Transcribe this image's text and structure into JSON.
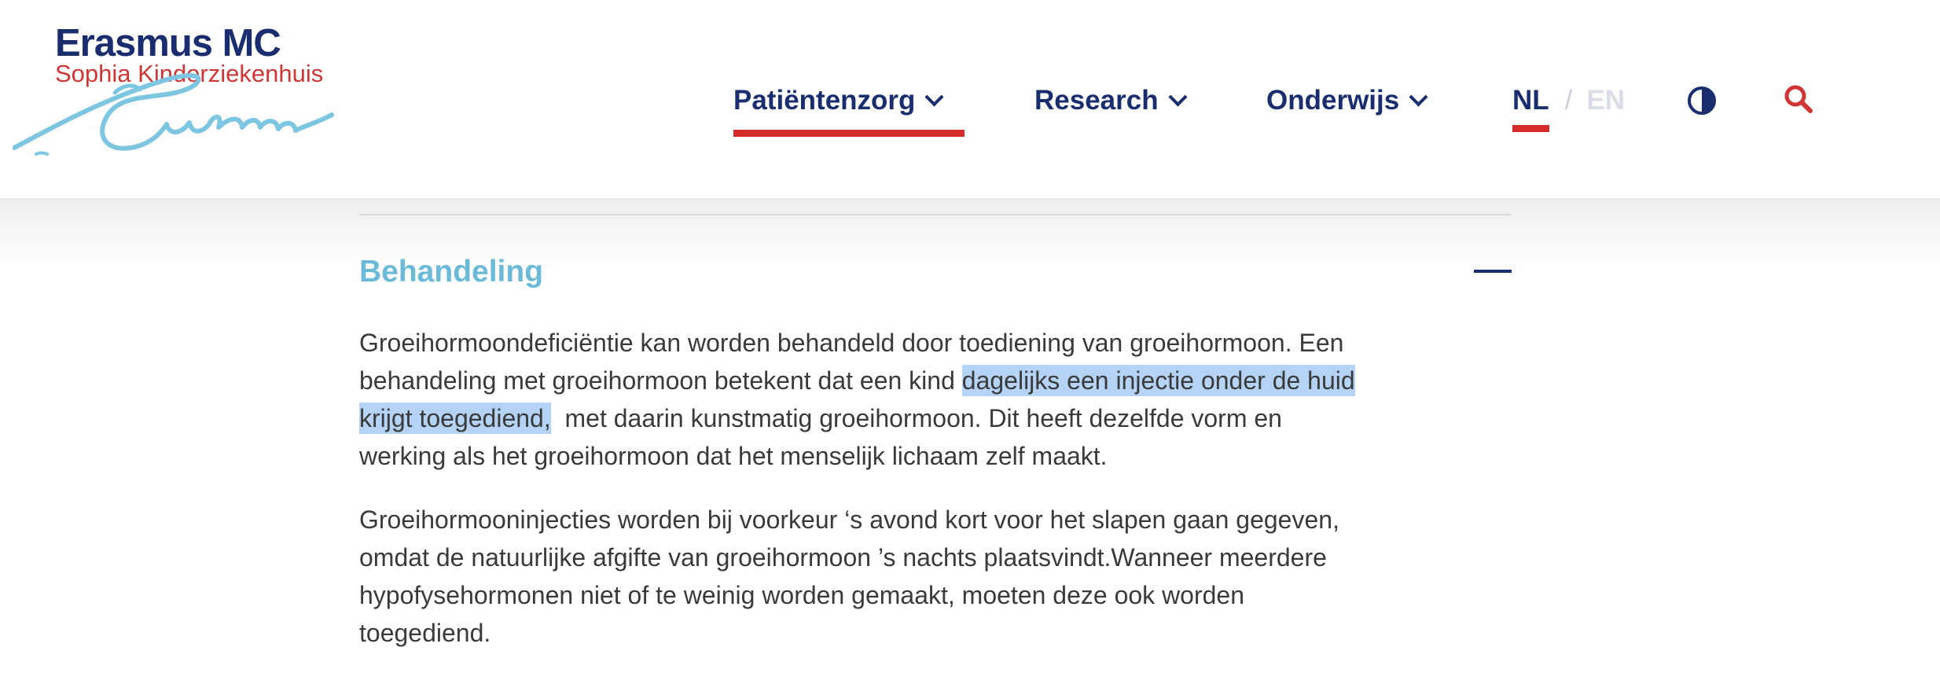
{
  "logo": {
    "title": "Erasmus MC",
    "subtitle": "Sophia Kinderziekenhuis"
  },
  "nav": {
    "items": [
      {
        "label": "Patiëntenzorg",
        "active": true
      },
      {
        "label": "Research",
        "active": false
      },
      {
        "label": "Onderwijs",
        "active": false
      }
    ],
    "lang": {
      "nl": "NL",
      "separator": "/",
      "en": "EN",
      "active": "NL"
    }
  },
  "icons": {
    "contrast": "contrast-icon",
    "search": "search-icon"
  },
  "colors": {
    "navy": "#1a2d6f",
    "red": "#d52b2b",
    "accent_blue": "#6bbad7",
    "selection": "#b4d3f5"
  },
  "section": {
    "title": "Behandeling",
    "para1": {
      "line1": "Groeihormoondeficiëntie kan worden behandeld door toediening van groeihormoon. Een",
      "line2_pre": "behandeling met groeihormoon betekent dat een kind ",
      "line2_hl": "dagelijks een injectie onder de huid",
      "line3_hl": "krijgt toegediend,",
      "line3_post": "  met daarin kunstmatig groeihormoon. Dit heeft dezelfde vorm en",
      "line4": "werking als het groeihormoon dat het menselijk lichaam zelf maakt."
    },
    "para2": {
      "line1": "Groeihormooninjecties worden bij voorkeur ‘s avond kort voor het slapen gaan gegeven,",
      "line2": "omdat de natuurlijke afgifte van groeihormoon ’s nachts plaatsvindt.Wanneer meerdere",
      "line3": "hypofysehormonen niet of te weinig worden gemaakt, moeten deze ook worden",
      "line4": "toegediend."
    }
  }
}
